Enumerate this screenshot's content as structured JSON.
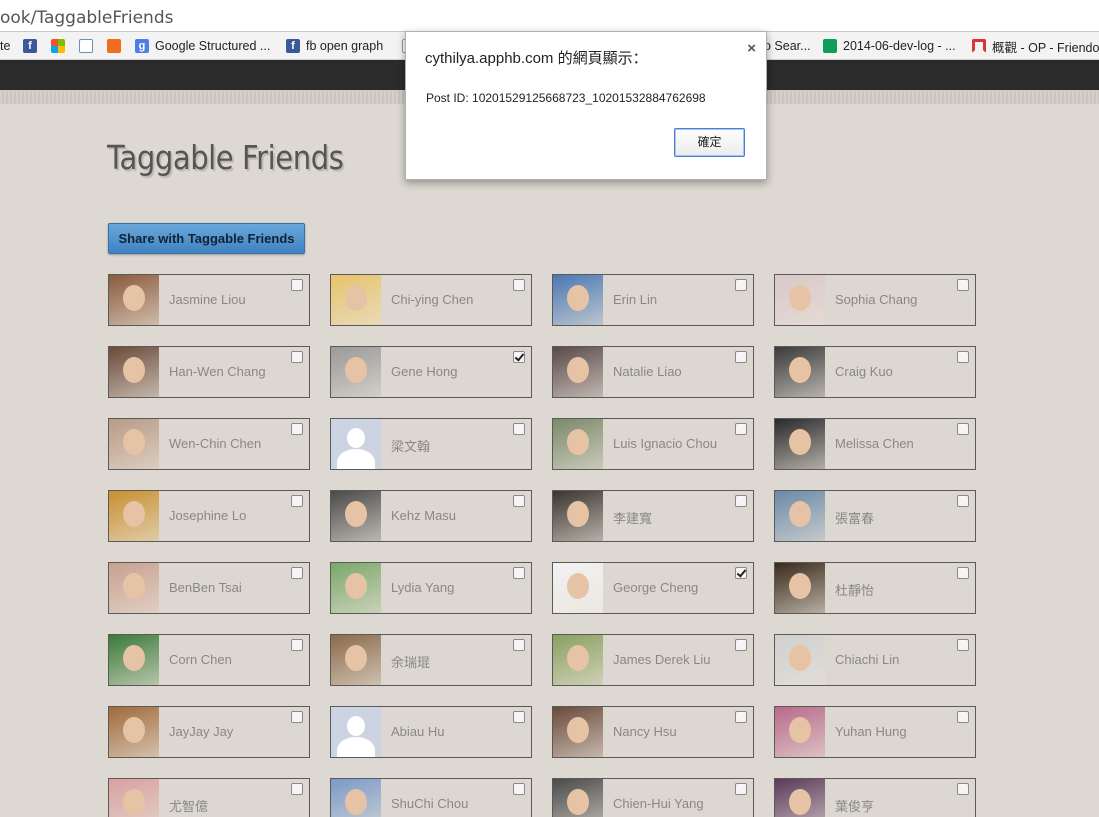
{
  "browser": {
    "url_partial": "ook/TaggableFriends",
    "bookmarks": [
      {
        "label": "te",
        "icon": "none-icon"
      },
      {
        "label": "",
        "icon": "facebook-icon"
      },
      {
        "label": "",
        "icon": "microsoft-icon"
      },
      {
        "label": "",
        "icon": "inbox-icon"
      },
      {
        "label": "",
        "icon": "chart-icon"
      },
      {
        "label": "Google Structured ...",
        "icon": "google-icon"
      },
      {
        "label": "fb open graph",
        "icon": "facebook-icon"
      },
      {
        "label": "o Sear...",
        "icon": "none-icon"
      },
      {
        "label": "2014-06-dev-log - ...",
        "icon": "sheet-icon"
      },
      {
        "label": "概觀 - OP - Friendo",
        "icon": "arc-icon"
      }
    ]
  },
  "page": {
    "title": "Taggable Friends",
    "share_button": "Share with Taggable Friends"
  },
  "friends": [
    {
      "name": "Jasmine Liou",
      "checked": false,
      "photo": "#8a5a3c"
    },
    {
      "name": "Chi-ying Chen",
      "checked": false,
      "photo": "#e8c36a"
    },
    {
      "name": "Erin Lin",
      "checked": false,
      "photo": "#4a78b4"
    },
    {
      "name": "Sophia Chang",
      "checked": false,
      "photo": "#d9c8c8"
    },
    {
      "name": "Han-Wen Chang",
      "checked": false,
      "photo": "#6a4a3a"
    },
    {
      "name": "Gene Hong",
      "checked": true,
      "photo": "#9a9a9a"
    },
    {
      "name": "Natalie Liao",
      "checked": false,
      "photo": "#5a4a4a"
    },
    {
      "name": "Craig Kuo",
      "checked": false,
      "photo": "#3a3a3a"
    },
    {
      "name": "Wen-Chin Chen",
      "checked": false,
      "photo": "#b89a86"
    },
    {
      "name": "梁文翰",
      "checked": false,
      "photo": "default"
    },
    {
      "name": "Luis Ignacio Chou",
      "checked": false,
      "photo": "#7a8a6a"
    },
    {
      "name": "Melissa Chen",
      "checked": false,
      "photo": "#2a2a2a"
    },
    {
      "name": "Josephine Lo",
      "checked": false,
      "photo": "#c89030"
    },
    {
      "name": "Kehz Masu",
      "checked": false,
      "photo": "#4a4a4a"
    },
    {
      "name": "李建寬",
      "checked": false,
      "photo": "#3a3430"
    },
    {
      "name": "張富春",
      "checked": false,
      "photo": "#6a8aa8"
    },
    {
      "name": "BenBen Tsai",
      "checked": false,
      "photo": "#c8a090"
    },
    {
      "name": "Lydia Yang",
      "checked": false,
      "photo": "#7aa86a"
    },
    {
      "name": "George Cheng",
      "checked": true,
      "photo": "#f2f2f2"
    },
    {
      "name": "杜靜怡",
      "checked": false,
      "photo": "#3a2a1a"
    },
    {
      "name": "Corn Chen",
      "checked": false,
      "photo": "#3a7a3a"
    },
    {
      "name": "余瑞琨",
      "checked": false,
      "photo": "#8a6a4a"
    },
    {
      "name": "James Derek Liu",
      "checked": false,
      "photo": "#8aa060"
    },
    {
      "name": "Chiachi Lin",
      "checked": false,
      "photo": "#d0d0d0"
    },
    {
      "name": "JayJay Jay",
      "checked": false,
      "photo": "#a06a3a"
    },
    {
      "name": "Abiau Hu",
      "checked": false,
      "photo": "default"
    },
    {
      "name": "Nancy Hsu",
      "checked": false,
      "photo": "#6a4a3a"
    },
    {
      "name": "Yuhan Hung",
      "checked": false,
      "photo": "#b86a8a"
    },
    {
      "name": "尤智億",
      "checked": false,
      "photo": "#d8a0a0"
    },
    {
      "name": "ShuChi Chou",
      "checked": false,
      "photo": "#7a9ac8"
    },
    {
      "name": "Chien-Hui Yang",
      "checked": false,
      "photo": "#4a4a4a"
    },
    {
      "name": "葉俊亨",
      "checked": false,
      "photo": "#5a3a5a"
    }
  ],
  "dialog": {
    "title": "cythilya.apphb.com 的網頁顯示：",
    "message": "Post ID: 10201529125668723_10201532884762698",
    "ok_label": "確定",
    "close_glyph": "×"
  }
}
